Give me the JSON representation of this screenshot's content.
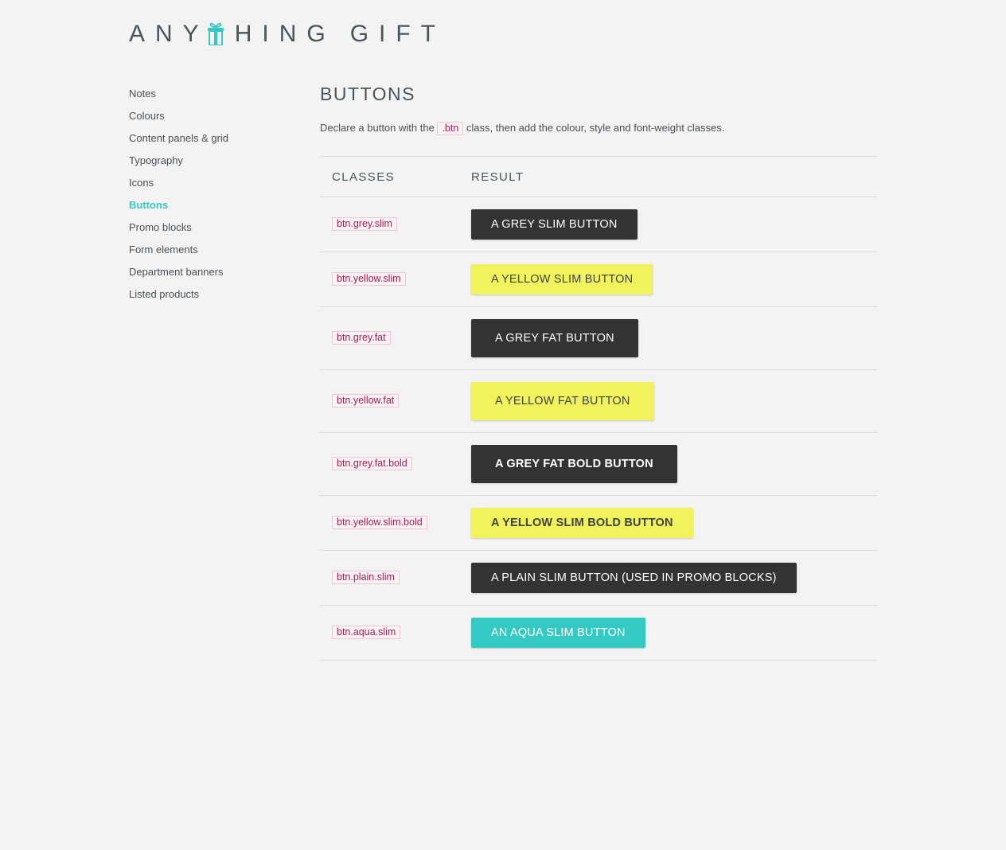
{
  "logo": {
    "part1": "ANY",
    "part2": "HING",
    "part3": "GIFT",
    "icon": "gift-icon",
    "accent": "#35c9c3"
  },
  "sidebar": {
    "items": [
      {
        "label": "Notes"
      },
      {
        "label": "Colours"
      },
      {
        "label": "Content panels & grid"
      },
      {
        "label": "Typography"
      },
      {
        "label": "Icons"
      },
      {
        "label": "Buttons",
        "active": true
      },
      {
        "label": "Promo blocks"
      },
      {
        "label": "Form elements"
      },
      {
        "label": "Department banners"
      },
      {
        "label": "Listed products"
      }
    ]
  },
  "main": {
    "title": "BUTTONS",
    "intro_before": "Declare a button with the",
    "intro_code": ".btn",
    "intro_after": "class, then add the colour, style and font-weight classes.",
    "table": {
      "headers": {
        "classes": "CLASSES",
        "result": "RESULT"
      },
      "rows": [
        {
          "cls": "btn.grey.slim",
          "label": "A GREY SLIM BUTTON"
        },
        {
          "cls": "btn.yellow.slim",
          "label": "A YELLOW SLIM BUTTON"
        },
        {
          "cls": "btn.grey.fat",
          "label": "A GREY FAT BUTTON"
        },
        {
          "cls": "btn.yellow.fat",
          "label": "A YELLOW FAT BUTTON"
        },
        {
          "cls": "btn.grey.fat.bold",
          "label": "A GREY FAT BOLD BUTTON"
        },
        {
          "cls": "btn.yellow.slim.bold",
          "label": "A YELLOW SLIM BOLD BUTTON"
        },
        {
          "cls": "btn.plain.slim",
          "label": "A PLAIN SLIM BUTTON (USED IN PROMO BLOCKS)"
        },
        {
          "cls": "btn.aqua.slim",
          "label": "AN AQUA SLIM BUTTON"
        }
      ]
    }
  },
  "colors": {
    "background": "#f3f3f3",
    "accent_aqua": "#35c9c3",
    "grey_button": "#333333",
    "yellow_button": "#f2f25c",
    "code_text": "#9c1f55"
  }
}
